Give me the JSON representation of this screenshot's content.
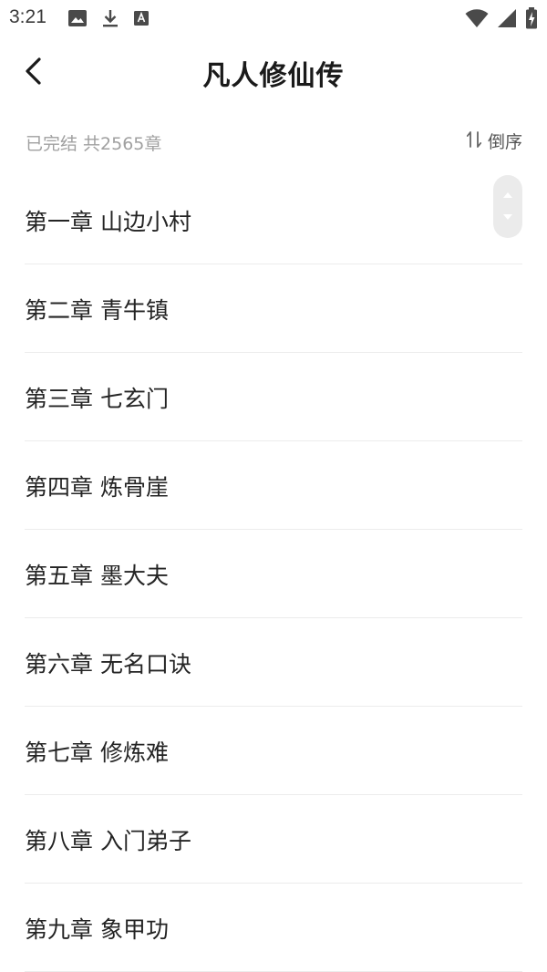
{
  "status_bar": {
    "time": "3:21",
    "icons": [
      "image-icon",
      "download-icon",
      "font-icon",
      "wifi-icon",
      "signal-icon",
      "battery-charging-icon"
    ]
  },
  "header": {
    "back_icon": "chevron-left-icon",
    "title": "凡人修仙传"
  },
  "info": {
    "status": "已完结 共2565章",
    "sort_icon": "sort-icon",
    "sort_label": "倒序"
  },
  "chapters": [
    {
      "title": "第一章 山边小村"
    },
    {
      "title": "第二章 青牛镇"
    },
    {
      "title": "第三章 七玄门"
    },
    {
      "title": "第四章 炼骨崖"
    },
    {
      "title": "第五章 墨大夫"
    },
    {
      "title": "第六章 无名口诀"
    },
    {
      "title": "第七章 修炼难"
    },
    {
      "title": "第八章 入门弟子"
    },
    {
      "title": "第九章 象甲功"
    }
  ],
  "colors": {
    "background": "#ffffff",
    "title": "#1a1a1a",
    "muted": "#a0a0a0",
    "divider": "#ececec",
    "scroll_handle": "#ebebeb"
  }
}
